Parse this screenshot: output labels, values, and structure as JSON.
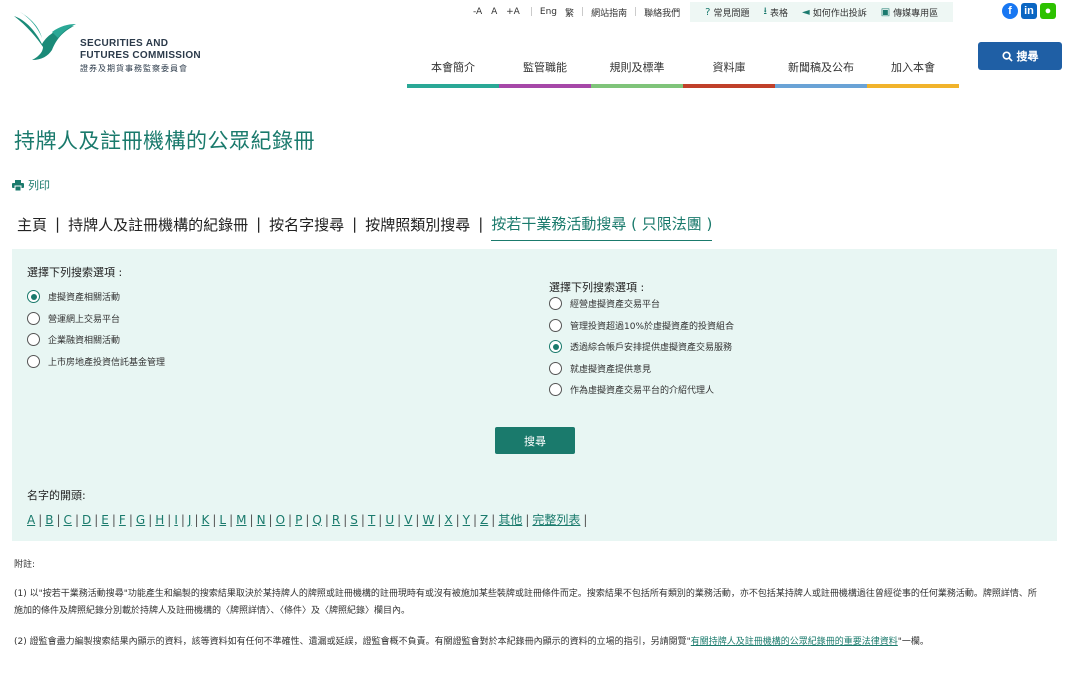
{
  "header": {
    "logo_en": "SECURITIES AND\nFUTURES COMMISSION",
    "logo_en_line1": "SECURITIES AND",
    "logo_en_line2": "FUTURES COMMISSION",
    "logo_zh": "證券及期貨事務監察委員會",
    "font_sizes": [
      "-A",
      "A",
      "+A"
    ],
    "lang": "Eng",
    "lang_alt": "繁",
    "site_map": "網站指南",
    "contact": "聯絡我們",
    "faq": "常見問題",
    "forms": "表格",
    "complaint": "如何作出投訴",
    "media": "傳媒專用區",
    "search_label": "搜尋",
    "nav": [
      {
        "label": "本會簡介",
        "color": "#2aa896"
      },
      {
        "label": "監管職能",
        "color": "#a648a8"
      },
      {
        "label": "規則及標準",
        "color": "#7fc47a"
      },
      {
        "label": "資料庫",
        "color": "#c0402a"
      },
      {
        "label": "新聞稿及公布",
        "color": "#6aa3d6"
      },
      {
        "label": "加入本會",
        "color": "#f1b32b"
      }
    ]
  },
  "page": {
    "title": "持牌人及註冊機構的公眾紀錄冊",
    "print": "列印",
    "breadcrumb": [
      "主頁",
      "持牌人及註冊機構的紀錄冊",
      "按名字搜尋",
      "按牌照類別搜尋",
      "按若干業務活動搜尋 ( 只限法團 )"
    ]
  },
  "search": {
    "left_title": "選擇下列搜索選項 :",
    "left_options": [
      {
        "label": "虛擬資產相關活動",
        "checked": true
      },
      {
        "label": "營運網上交易平台",
        "checked": false
      },
      {
        "label": "企業融資相關活動",
        "checked": false
      },
      {
        "label": "上市房地產投資信託基金管理",
        "checked": false
      }
    ],
    "right_title": "選擇下列搜索選項 :",
    "right_options": [
      {
        "label": "經營虛擬資產交易平台",
        "checked": false
      },
      {
        "label": "管理投資超過10%於虛擬資產的投資組合",
        "checked": false
      },
      {
        "label": "透過綜合帳戶安排提供虛擬資產交易服務",
        "checked": true
      },
      {
        "label": "就虛擬資產提供意見",
        "checked": false
      },
      {
        "label": "作為虛擬資產交易平台的介紹代理人",
        "checked": false
      }
    ],
    "submit": "搜尋",
    "name_title": "名字的開頭:",
    "letters": [
      "A",
      "B",
      "C",
      "D",
      "E",
      "F",
      "G",
      "H",
      "I",
      "J",
      "K",
      "L",
      "M",
      "N",
      "O",
      "P",
      "Q",
      "R",
      "S",
      "T",
      "U",
      "V",
      "W",
      "X",
      "Y",
      "Z"
    ],
    "others": "其他",
    "full_list": "完整列表"
  },
  "notes": {
    "label": "附註:",
    "note1": "(1) 以\"按若干業務活動搜尋\"功能產生和編製的搜索結果取決於某持牌人的牌照或註冊機構的註冊現時有或沒有被施加某些裝牌或註冊條件而定。搜索結果不包括所有類別的業務活動，亦不包括某持牌人或註冊機構過往曾經從事的任何業務活動。牌照詳情、所施加的條件及牌照紀錄分別載於持牌人及註冊機構的〈牌照詳情〉、〈條件〉及〈牌照紀錄〉欄目內。",
    "note2_pre": "(2) 證監會盡力編製搜索結果內顯示的資料，該等資料如有任何不準確性、遺漏或延誤，證監會概不負責。有關證監會對於本紀錄冊內顯示的資料的立場的指引，另請閱覽\"",
    "note2_link": "有關持牌人及註冊機構的公眾紀錄冊的重要法律資料",
    "note2_post": "\"一欄。"
  },
  "colors": {
    "brand": "#1a7a6c",
    "panel_bg": "#e8f6f3",
    "search_btn": "#1f5fa5"
  }
}
